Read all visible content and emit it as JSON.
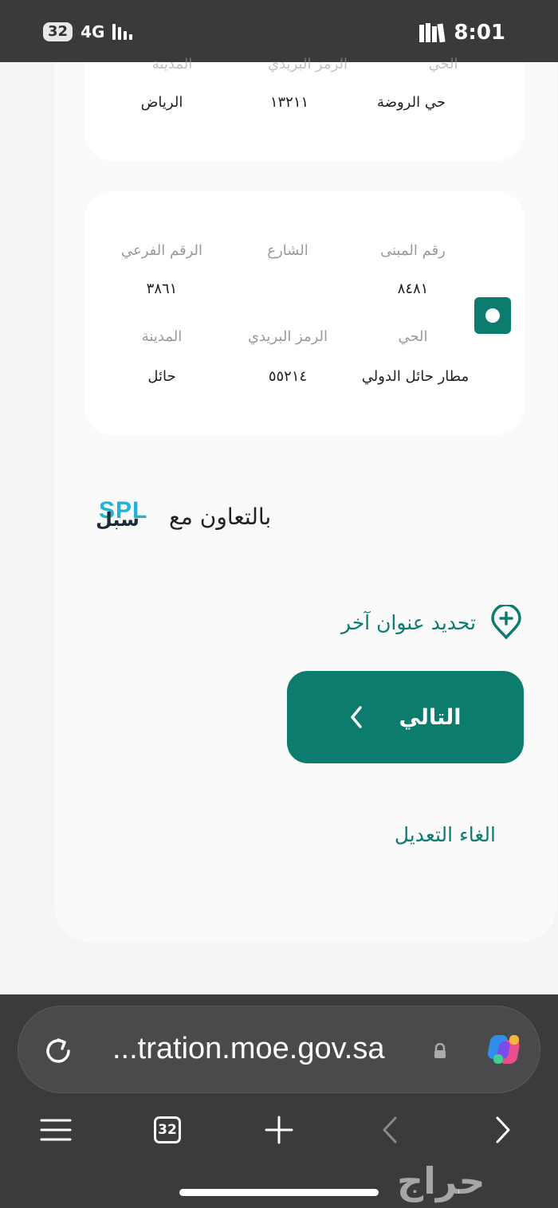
{
  "status_bar": {
    "tab_badge": "32",
    "network": "4G",
    "time": "8:01"
  },
  "address_card_1": {
    "labels": {
      "district": "الحي",
      "postal_code": "الرمز البريدي",
      "city": "المدينة"
    },
    "values": {
      "district": "حي الروضة",
      "postal_code": "١٣٢١١",
      "city": "الرياض"
    }
  },
  "address_card_2": {
    "labels": {
      "building_number": "رقم المبنى",
      "street": "الشارع",
      "sub_number": "الرقم الفرعي",
      "district": "الحي",
      "postal_code": "الرمز البريدي",
      "city": "المدينة"
    },
    "values": {
      "building_number": "٨٤٨١",
      "street": "",
      "sub_number": "٣٨٦١",
      "district": "مطار حائل الدولي",
      "postal_code": "٥٥٢١٤",
      "city": "حائل"
    },
    "selected": true
  },
  "cooperation": {
    "text": "بالتعاون مع",
    "logo_latin": "SPL",
    "logo_arabic": "سبل"
  },
  "other_address": {
    "label": "تحديد عنوان آخر"
  },
  "next_button": {
    "label": "التالي"
  },
  "cancel_link": {
    "label": "الغاء التعديل"
  },
  "browser": {
    "url": "...tration.moe.gov.sa",
    "tab_count": "32"
  },
  "watermark": {
    "text": "حراج"
  },
  "colors": {
    "accent": "#0c7c6f",
    "status_bar": "#3a3a3a",
    "browser_bar": "#3b3b3d",
    "spl_blue": "#22b2d3"
  }
}
